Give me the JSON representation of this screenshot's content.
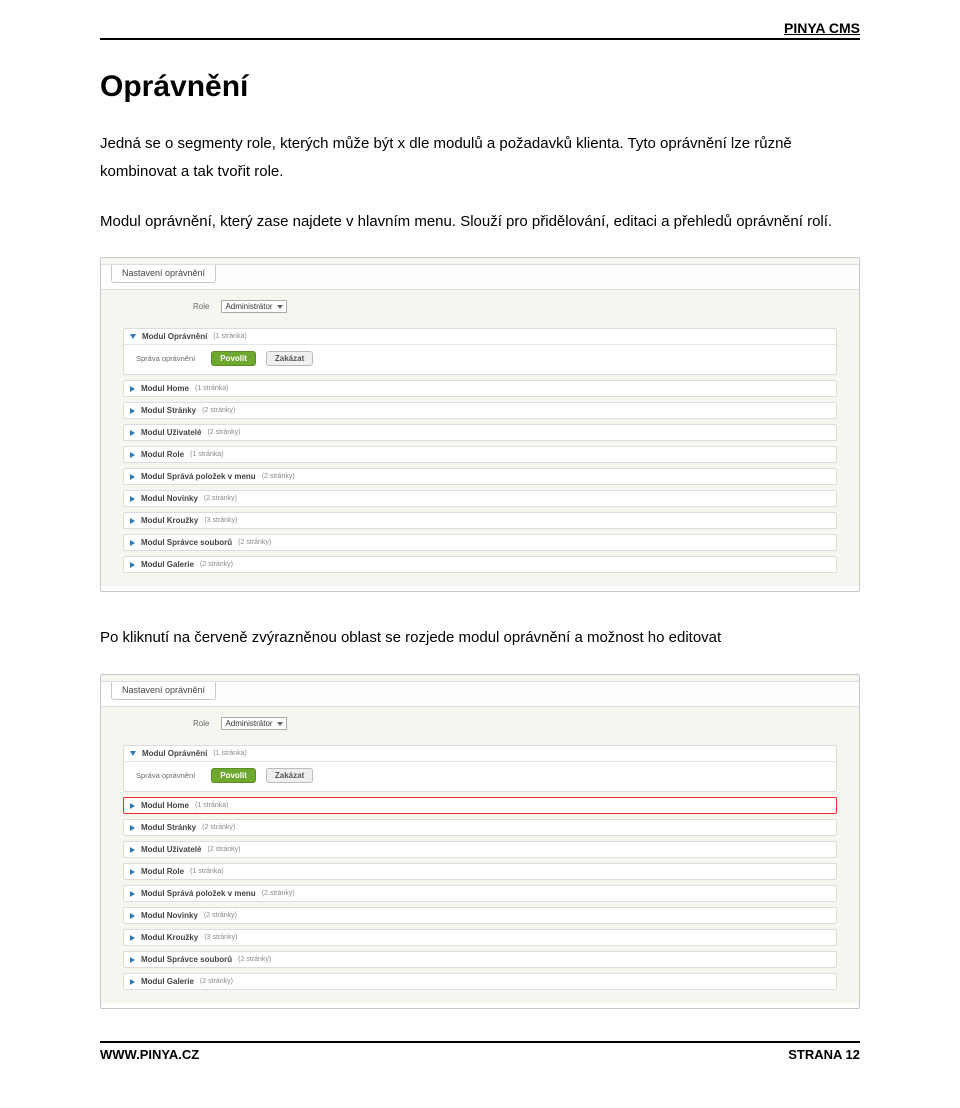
{
  "brand": "PINYA CMS",
  "page_title": "Oprávnění",
  "para1": "Jedná se o segmenty role, kterých může být x dle modulů a požadavků klienta. Tyto oprávnění lze různě kombinovat a tak tvořit role.",
  "para2": "Modul oprávnění, který zase najdete v hlavním menu. Slouží pro přidělování, editaci a přehledů oprávnění rolí.",
  "para3": "Po kliknutí na červeně zvýrazněnou oblast se rozjede modul oprávnění a možnost ho editovat",
  "shot": {
    "tab_title": "Nastavení oprávnění",
    "role_label": "Role",
    "role_value": "Administrátor",
    "expanded": {
      "title": "Modul Oprávnění",
      "count": "(1 stránka)",
      "sub_label": "Správa oprávnění",
      "allow": "Povolit",
      "deny": "Zakázat"
    },
    "rows": [
      {
        "title": "Modul Home",
        "count": "(1 stránka)"
      },
      {
        "title": "Modul Stránky",
        "count": "(2 stránky)"
      },
      {
        "title": "Modul Uživatelé",
        "count": "(2 stránky)"
      },
      {
        "title": "Modul Role",
        "count": "(1 stránka)"
      },
      {
        "title": "Modul Správá položek v menu",
        "count": "(2 stránky)"
      },
      {
        "title": "Modul Novinky",
        "count": "(2 stránky)"
      },
      {
        "title": "Modul Kroužky",
        "count": "(3 stránky)"
      },
      {
        "title": "Modul Správce souborů",
        "count": "(2 stránky)"
      },
      {
        "title": "Modul Galerie",
        "count": "(2 stránky)"
      }
    ]
  },
  "footer": {
    "site": "WWW.PINYA.CZ",
    "page": "STRANA 12"
  }
}
